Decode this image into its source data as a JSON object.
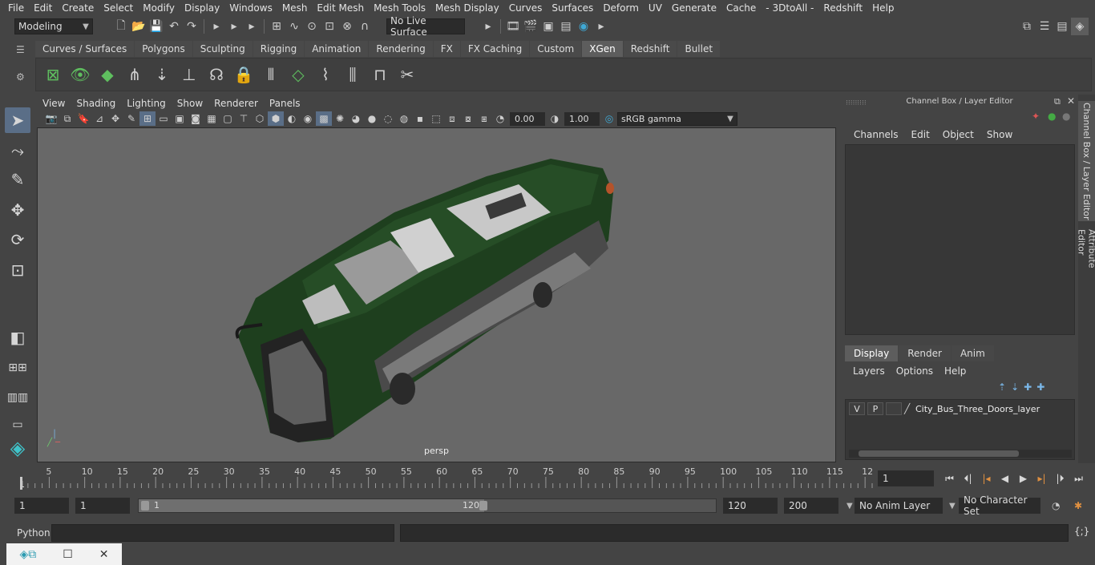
{
  "menubar": [
    "File",
    "Edit",
    "Create",
    "Select",
    "Modify",
    "Display",
    "Windows",
    "Mesh",
    "Edit Mesh",
    "Mesh Tools",
    "Mesh Display",
    "Curves",
    "Surfaces",
    "Deform",
    "UV",
    "Generate",
    "Cache",
    "- 3DtoAll -",
    "Redshift",
    "Help"
  ],
  "status": {
    "mode": "Modeling",
    "live_surface": "No Live Surface"
  },
  "shelf": {
    "tabs": [
      "Curves / Surfaces",
      "Polygons",
      "Sculpting",
      "Rigging",
      "Animation",
      "Rendering",
      "FX",
      "FX Caching",
      "Custom",
      "XGen",
      "Redshift",
      "Bullet"
    ],
    "active_tab": "XGen"
  },
  "viewport": {
    "menu": [
      "View",
      "Shading",
      "Lighting",
      "Show",
      "Renderer",
      "Panels"
    ],
    "exposure": "0.00",
    "gamma": "1.00",
    "color_space": "sRGB gamma",
    "camera_label": "persp"
  },
  "right_panel": {
    "title": "Channel Box / Layer Editor",
    "menu": [
      "Channels",
      "Edit",
      "Object",
      "Show"
    ],
    "tabs": [
      "Display",
      "Render",
      "Anim"
    ],
    "active_tab": "Display",
    "layers_menu": [
      "Layers",
      "Options",
      "Help"
    ],
    "layer": {
      "visible": "V",
      "playback": "P",
      "name": "City_Bus_Three_Doors_layer"
    },
    "side_tabs": [
      "Channel Box / Layer Editor",
      "Attribute Editor"
    ]
  },
  "timeline": {
    "ticks": [
      "5",
      "10",
      "15",
      "20",
      "25",
      "30",
      "35",
      "40",
      "45",
      "50",
      "55",
      "60",
      "65",
      "70",
      "75",
      "80",
      "85",
      "90",
      "95",
      "100",
      "105",
      "110",
      "115",
      "12"
    ],
    "start_label": "1",
    "current_frame": "1"
  },
  "range": {
    "start": "1",
    "playback_start": "1",
    "slider_start": "1",
    "slider_end": "120",
    "end": "120",
    "anim_end": "200",
    "anim_layer": "No Anim Layer",
    "character_set": "No Character Set"
  },
  "command": {
    "language": "Python"
  },
  "colors": {
    "accent": "#5a6e87",
    "bus_green": "#1f4a1f",
    "viewport_bg": "#686868"
  }
}
